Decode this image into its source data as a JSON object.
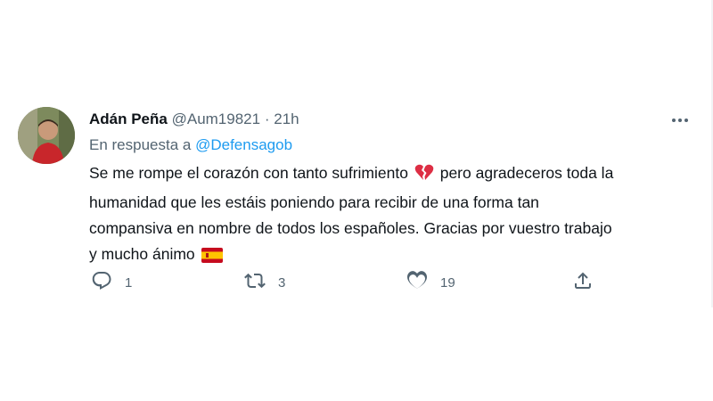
{
  "tweet": {
    "author_name": "Adán Peña",
    "handle": "@Aum19821",
    "separator": "·",
    "time": "21h",
    "reply_prefix": "En respuesta a",
    "reply_to": "@Defensagob",
    "text_lines": [
      "Se me rompe el corazón con tanto sufrimiento",
      "pero agradeceros toda la",
      "humanidad que les estáis poniendo para recibir de una forma tan",
      "compansiva en nombre de todos los españoles. Gracias por vuestro trabajo",
      "y mucho ánimo"
    ],
    "emojis": [
      "broken-heart-emoji",
      "spain-flag-emoji"
    ]
  },
  "actions": {
    "reply_count": "1",
    "retweet_count": "3",
    "like_count": "19"
  },
  "icons": {
    "reply": "reply-icon",
    "retweet": "retweet-icon",
    "like": "heart-icon",
    "share": "share-icon",
    "more": "more-icon"
  },
  "colors": {
    "link": "#1d9bf0",
    "secondary_text": "#536471",
    "primary_text": "#0f1419"
  }
}
